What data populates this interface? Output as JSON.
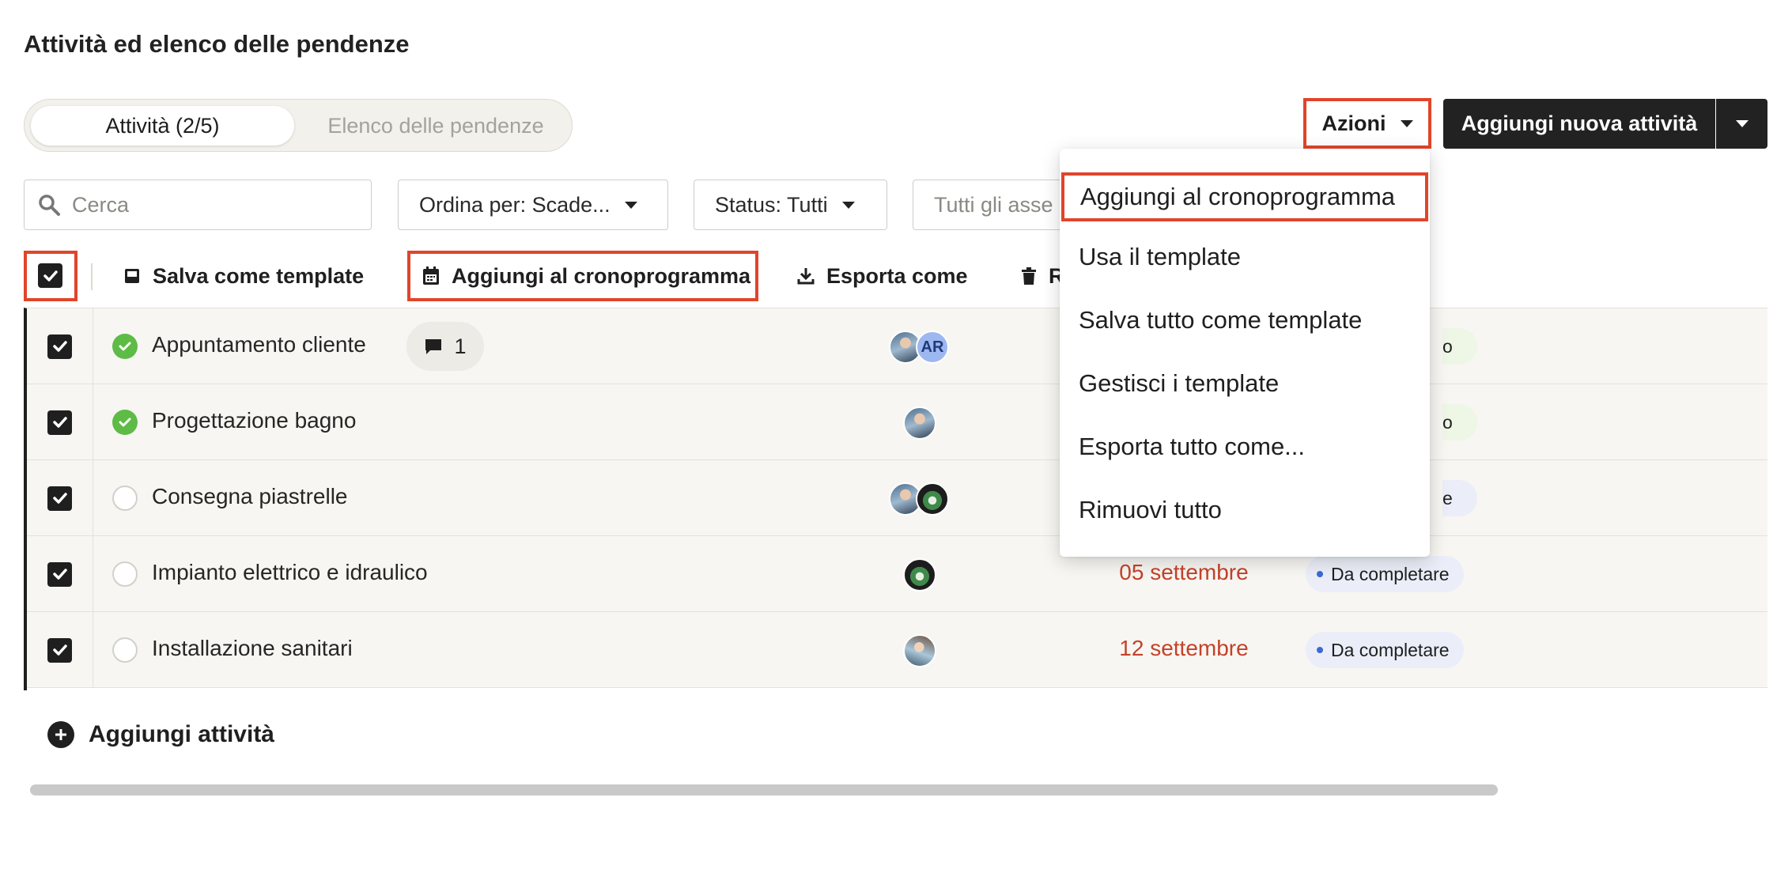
{
  "page": {
    "title": "Attività ed elenco delle pendenze"
  },
  "tabs": [
    {
      "label": "Attività (2/5)",
      "active": true
    },
    {
      "label": "Elenco delle pendenze",
      "active": false
    }
  ],
  "header_actions": {
    "azioni_label": "Azioni",
    "add_task_label": "Aggiungi nuova attività"
  },
  "filters": {
    "search_placeholder": "Cerca",
    "sort_label": "Ordina per: Scade...",
    "status_label": "Status: Tutti",
    "assignee_label": "Tutti gli asse"
  },
  "bulk_actions": {
    "save_template": "Salva come template",
    "add_schedule": "Aggiungi al cronoprogramma",
    "export": "Esporta come",
    "remove": "R"
  },
  "tasks": [
    {
      "name": "Appuntamento cliente",
      "done": true,
      "comments": "1",
      "assignees": [
        "photo",
        "AR"
      ],
      "badge_tail": "o"
    },
    {
      "name": "Progettazione bagno",
      "done": true,
      "assignees": [
        "photo"
      ],
      "badge_tail": "o"
    },
    {
      "name": "Consegna piastrelle",
      "done": false,
      "assignees": [
        "photo",
        "green"
      ],
      "badge_tail": "e"
    },
    {
      "name": "Impianto elettrico e idraulico",
      "done": false,
      "assignees": [
        "green"
      ],
      "due": "05 settembre",
      "status": "Da completare"
    },
    {
      "name": "Installazione sanitari",
      "done": false,
      "assignees": [
        "photo"
      ],
      "due": "12 settembre",
      "status": "Da completare"
    }
  ],
  "add_task_row": {
    "label": "Aggiungi attività"
  },
  "actions_menu": {
    "items": [
      "Aggiungi al cronoprogramma",
      "Usa il template",
      "Salva tutto come template",
      "Gestisci i template",
      "Esporta tutto come...",
      "Rimuovi tutto"
    ]
  },
  "colors": {
    "accent_highlight": "#e0452a",
    "done_green": "#5dbb46",
    "due_red": "#c4422b",
    "primary_dark": "#222222"
  }
}
